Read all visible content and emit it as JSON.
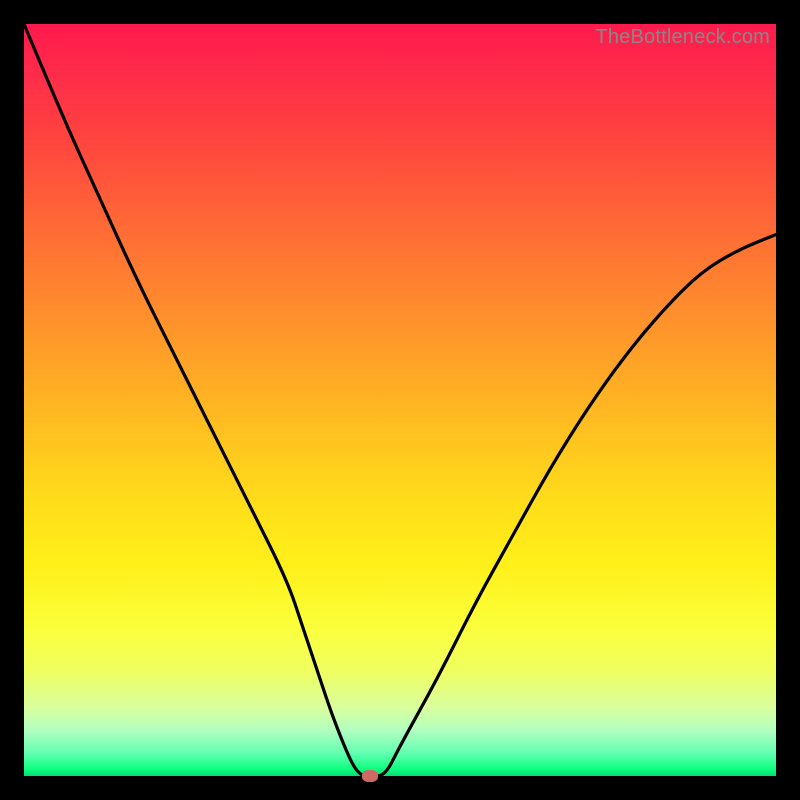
{
  "watermark": "TheBottleneck.com",
  "colors": {
    "frame": "#000000",
    "curve": "#000000",
    "marker": "#cc6a63"
  },
  "chart_data": {
    "type": "line",
    "title": "",
    "xlabel": "",
    "ylabel": "",
    "xlim": [
      0,
      100
    ],
    "ylim": [
      0,
      100
    ],
    "grid": false,
    "legend": false,
    "series": [
      {
        "name": "curve",
        "x": [
          0,
          5,
          10,
          15,
          20,
          25,
          30,
          35,
          37,
          39,
          41,
          43,
          44,
          45,
          46,
          48,
          50,
          55,
          60,
          65,
          70,
          75,
          80,
          85,
          90,
          95,
          100
        ],
        "y": [
          100,
          88,
          77,
          66,
          56,
          46,
          36,
          26,
          20,
          14,
          8,
          3,
          1,
          0,
          0,
          0,
          4,
          13,
          23,
          32,
          41,
          49,
          56,
          62,
          67,
          70,
          72
        ]
      }
    ],
    "marker": {
      "x": 46,
      "y": 0
    }
  }
}
